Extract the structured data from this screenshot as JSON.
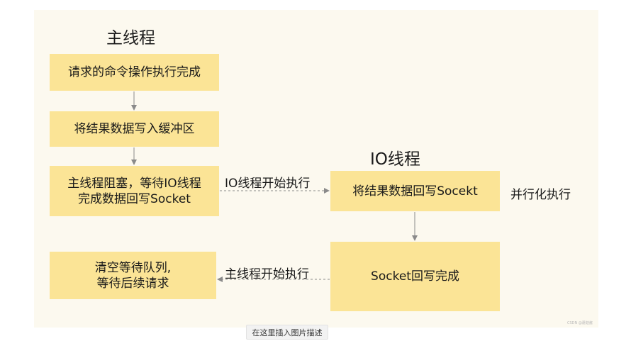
{
  "diagram": {
    "main_thread_title": "主线程",
    "io_thread_title": "IO线程",
    "boxes": {
      "command_done": "请求的命令操作执行完成",
      "write_buffer": "将结果数据写入缓冲区",
      "main_blocked": "主线程阻塞，等待IO线程\n完成数据回写Socket",
      "io_write_socket": "将结果数据回写Socekt",
      "socket_done": "Socket回写完成",
      "clear_queue": "清空等待队列,\n等待后续请求"
    },
    "edge_labels": {
      "io_start": "IO线程开始执行",
      "main_start": "主线程开始执行",
      "parallel": "并行化执行"
    },
    "watermark": "CSDN @蘑菇酱"
  },
  "caption_button": "在这里插入图片描述",
  "colors": {
    "canvas_bg": "#fcf9ef",
    "box_fill": "#fbe496",
    "arrow": "#8a8a8a",
    "text": "#1a1a1a"
  }
}
